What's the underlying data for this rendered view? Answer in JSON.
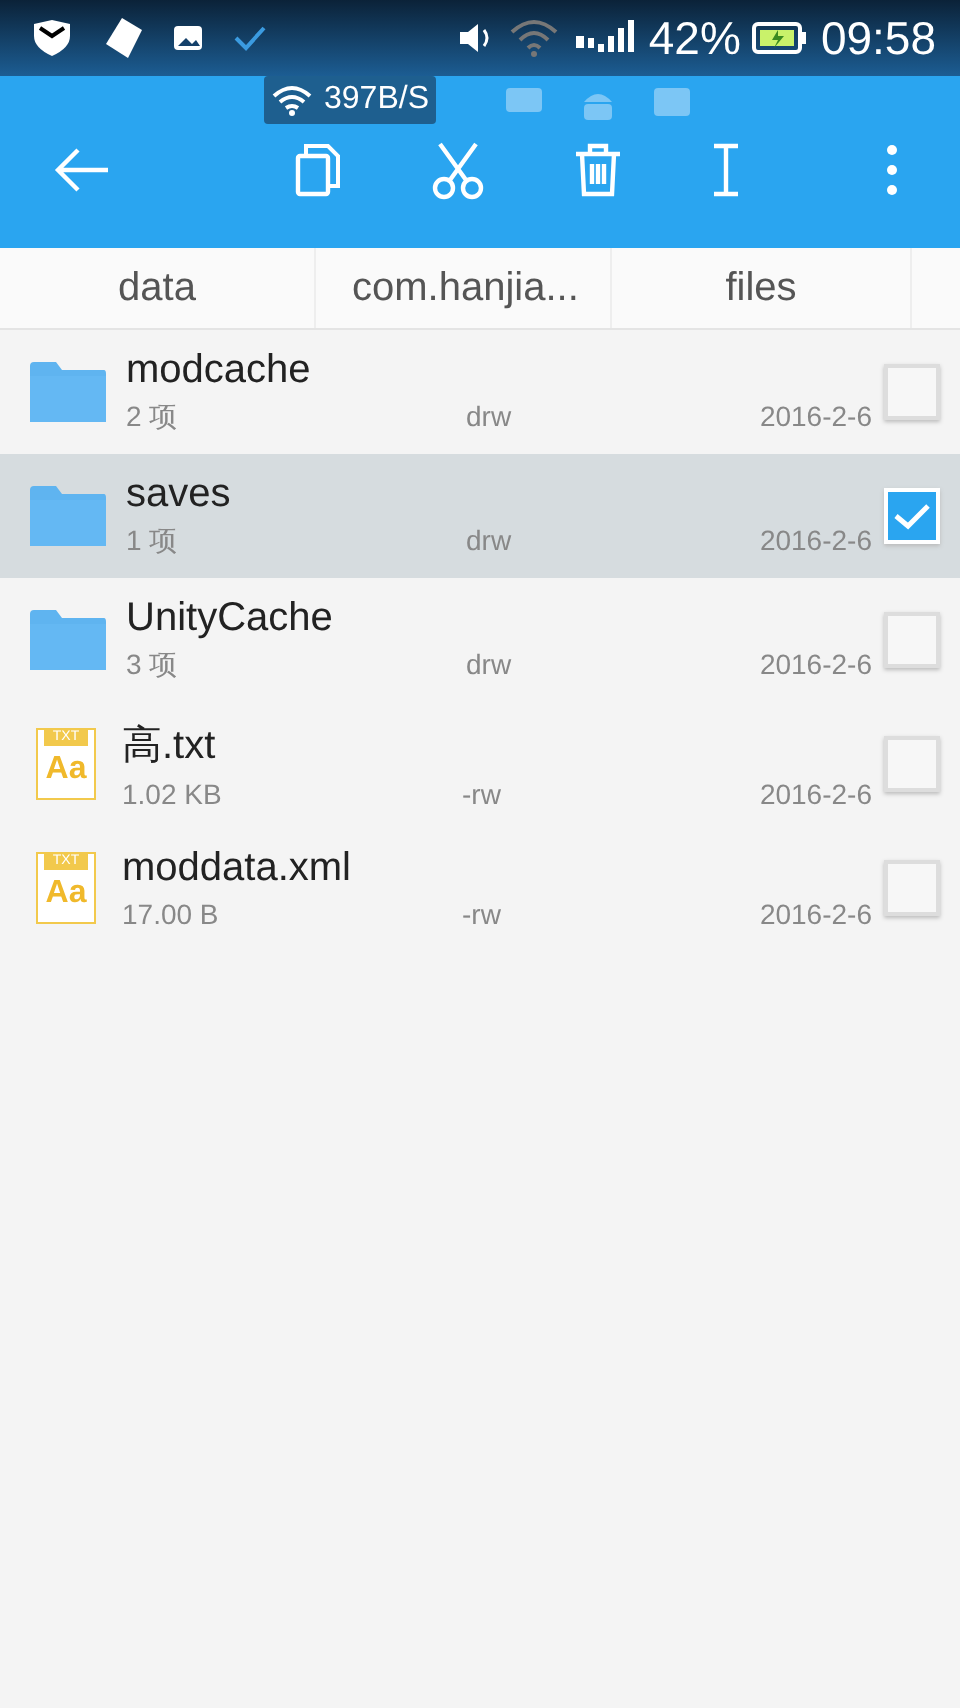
{
  "status_bar": {
    "battery": "42%",
    "time": "09:58"
  },
  "speed_overlay": {
    "text": "397B/S"
  },
  "breadcrumb": [
    {
      "label": "data"
    },
    {
      "label": "com.hanjia..."
    },
    {
      "label": "files"
    }
  ],
  "files": [
    {
      "kind": "folder",
      "name": "modcache",
      "info": "2 项",
      "perms": "drw",
      "date": "2016-2-6",
      "selected": false
    },
    {
      "kind": "folder",
      "name": "saves",
      "info": "1 项",
      "perms": "drw",
      "date": "2016-2-6",
      "selected": true
    },
    {
      "kind": "folder",
      "name": "UnityCache",
      "info": "3 项",
      "perms": "drw",
      "date": "2016-2-6",
      "selected": false
    },
    {
      "kind": "text",
      "badge": "TXT",
      "letters": "Aa",
      "name": "高.txt",
      "info": "1.02 KB",
      "perms": "-rw",
      "date": "2016-2-6",
      "selected": false
    },
    {
      "kind": "text",
      "badge": "TXT",
      "letters": "Aa",
      "name": "moddata.xml",
      "info": "17.00 B",
      "perms": "-rw",
      "date": "2016-2-6",
      "selected": false
    }
  ]
}
